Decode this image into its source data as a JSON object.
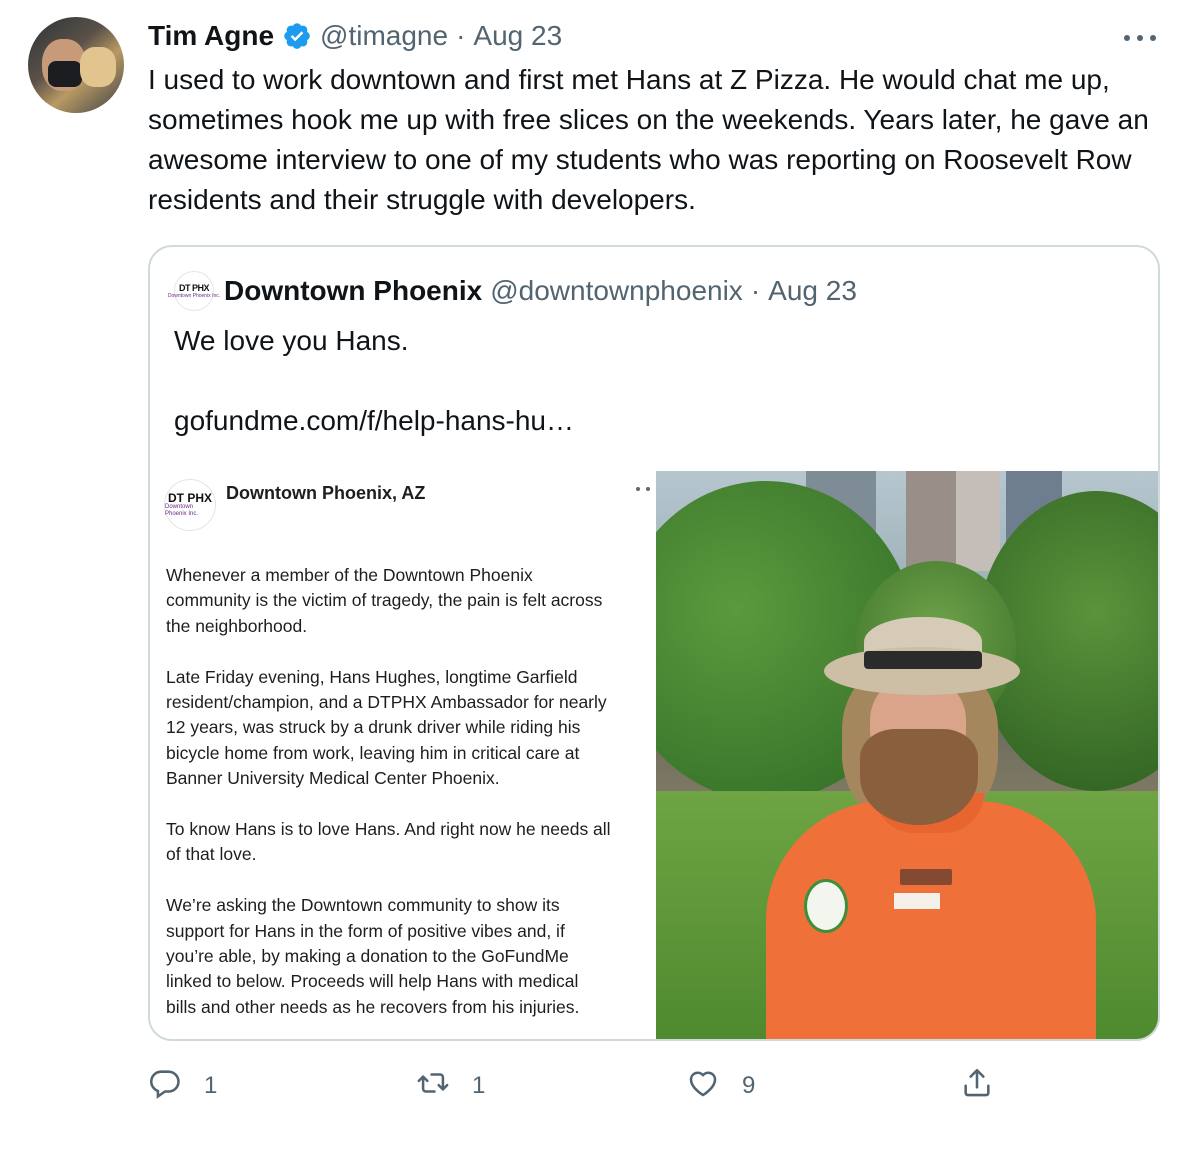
{
  "tweet": {
    "author_name": "Tim Agne",
    "author_handle": "@timagne",
    "separator": "·",
    "date": "Aug 23",
    "text": "I used to work downtown and first met Hans at Z Pizza. He would chat me up, sometimes hook me up with free slices on the weekends. Years later, he gave an awesome interview to one of my students who was reporting on Roosevelt Row residents and their struggle with developers."
  },
  "quote": {
    "author_name": "Downtown Phoenix",
    "author_handle": "@downtownphoenix",
    "separator": "·",
    "date": "Aug 23",
    "avatar_text": "DT PHX",
    "avatar_sub": "Downtown Phoenix Inc.",
    "text": "We love you Hans.",
    "link": "gofundme.com/f/help-hans-hu…"
  },
  "media_post": {
    "page_name": "Downtown Phoenix, AZ",
    "avatar_text": "DT PHX",
    "avatar_sub": "Downtown Phoenix Inc.",
    "lines": [
      "Whenever a member of the Downtown Phoenix",
      "community is the victim of tragedy, the pain is felt across",
      "the neighborhood.",
      "",
      "Late Friday evening, Hans Hughes, longtime Garfield",
      "resident/champion, and a DTPHX Ambassador for nearly",
      "12 years, was struck by a drunk driver while riding his",
      "bicycle home from work, leaving him in critical care at",
      "Banner University Medical Center Phoenix.",
      "",
      "To know Hans is to love Hans. And right now he needs all",
      "of that love.",
      "",
      "We’re asking the Downtown community to show its",
      "support for Hans in the form of positive vibes and, if",
      "you’re able, by making a donation to the GoFundMe",
      "linked to below. Proceeds will help Hans with medical",
      "bills and other needs as he recovers from his injuries."
    ]
  },
  "actions": {
    "reply_count": "1",
    "retweet_count": "1",
    "like_count": "9"
  },
  "colors": {
    "text_primary": "#0f1419",
    "text_secondary": "#536471",
    "verified_blue": "#1d9bf0",
    "border": "#cfd9de"
  },
  "icons": [
    "verified-badge-icon",
    "more-icon",
    "reply-icon",
    "retweet-icon",
    "like-icon",
    "share-icon"
  ]
}
